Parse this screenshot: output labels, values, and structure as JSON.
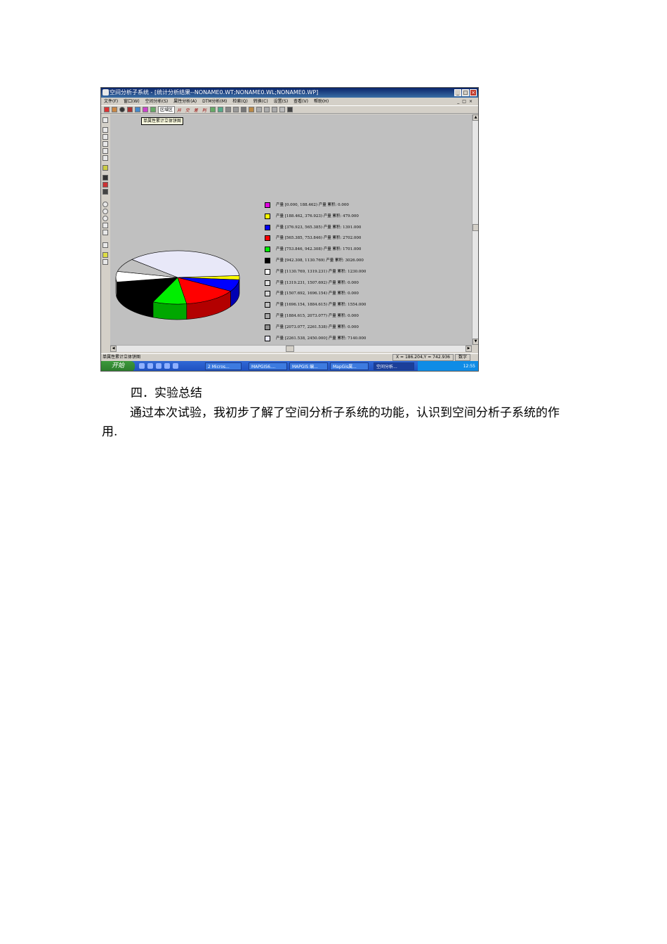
{
  "window": {
    "title": "空间分析子系统 - [统计分析结果--NONAME0.WT;NONAME0.WL;NONAME0.WP]",
    "menu": [
      "文件(F)",
      "窗口(W)",
      "空间分析(S)",
      "属性分析(A)",
      "DTM分析(M)",
      "检索(Q)",
      "转换(C)",
      "设置(S)",
      "查看(V)",
      "帮助(H)"
    ],
    "toolbar_combo": "区域区",
    "toolbar_text": "并 交 差 判",
    "tooltip": "单属性累计立体饼图"
  },
  "chart_data": {
    "type": "pie",
    "title": "",
    "style": "3d",
    "legend": "right",
    "slices": [
      {
        "label": "产量 [0.000, 188.462)  产量 累积: 0.000",
        "value": 0,
        "color": "#e000e0"
      },
      {
        "label": "产量 [188.462, 376.923)  产量 累积: 479.000",
        "value": 479,
        "color": "#ffff00"
      },
      {
        "label": "产量 [376.923, 565.385)  产量 累积: 1391.000",
        "value": 1391,
        "color": "#0000ff"
      },
      {
        "label": "产量 [565.385, 753.846)  产量 累积: 2702.000",
        "value": 2702,
        "color": "#ff0000"
      },
      {
        "label": "产量 [753.846, 942.308)  产量 累积: 1701.000",
        "value": 1701,
        "color": "#00ee00"
      },
      {
        "label": "产量 [942.308, 1130.769)  产量 累积: 3026.000",
        "value": 3026,
        "color": "#000000"
      },
      {
        "label": "产量 [1130.769, 1319.231)  产量 累积: 1230.000",
        "value": 1230,
        "color": "#ffffff"
      },
      {
        "label": "产量 [1319.231, 1507.692)  产量 累积: 0.000",
        "value": 0,
        "color": "#e0e0e0"
      },
      {
        "label": "产量 [1507.692, 1696.154)  产量 累积: 0.000",
        "value": 0,
        "color": "#d8d8d8"
      },
      {
        "label": "产量 [1696.154, 1884.615)  产量 累积: 1554.000",
        "value": 1554,
        "color": "#c0c0c0"
      },
      {
        "label": "产量 [1884.615, 2073.077)  产量 累积: 0.000",
        "value": 0,
        "color": "#a8a8a8"
      },
      {
        "label": "产量 [2073.077, 2261.538)  产量 累积: 0.000",
        "value": 0,
        "color": "#909090"
      },
      {
        "label": "产量 [2261.538, 2450.000]  产量 累积: 7140.000",
        "value": 7140,
        "color": "#e8e8f8"
      }
    ]
  },
  "statusbar": {
    "left": "单属性累计立体饼图",
    "coords": "X = 186.204,Y = 742.936",
    "mode": "数字"
  },
  "taskbar": {
    "start": "开始",
    "tasks": [
      "2 Micros...",
      "MAPGIS6....",
      "MAPGIS 编...",
      "MapGis属...",
      "空间分析..."
    ],
    "clock": "12:55"
  },
  "doc": {
    "heading": "四．实验总结",
    "paragraph": "通过本次试验，我初步了解了空间分析子系统的功能，认识到空间分析子系统的作用."
  }
}
